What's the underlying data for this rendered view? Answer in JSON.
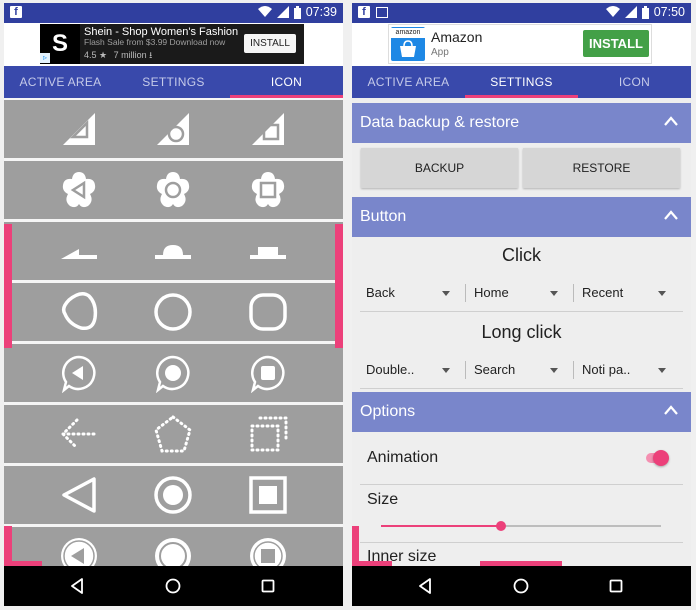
{
  "status_bar": {
    "time_left": "07:39",
    "time_right": "07:50"
  },
  "left_ad": {
    "logo_letter": "S",
    "title": "Shein - Shop Women's Fashion",
    "subtitle": "Flash Sale from $3.99 Download now",
    "rating": "4.5",
    "star": "★",
    "installs": "7 million",
    "button": "INSTALL"
  },
  "right_ad": {
    "title": "Amazon",
    "subtitle": "App",
    "button": "INSTALL",
    "logo_text": "amazon"
  },
  "left_tabs": [
    "ACTIVE AREA",
    "SETTINGS",
    "ICON"
  ],
  "right_tabs": [
    "ACTIVE AREA",
    "SETTINGS",
    "ICON"
  ],
  "settings": {
    "backup_section": {
      "title": "Data backup & restore",
      "backup": "BACKUP",
      "restore": "RESTORE"
    },
    "button_section": {
      "title": "Button",
      "click_label": "Click",
      "click_options": [
        "Back",
        "Home",
        "Recent"
      ],
      "long_click_label": "Long click",
      "long_click_options": [
        "Double..",
        "Search",
        "Noti pa.."
      ]
    },
    "options_section": {
      "title": "Options",
      "animation": "Animation",
      "size": "Size",
      "inner_size": "Inner size",
      "animation_on": true,
      "size_level": 0.43
    }
  },
  "icon_rows": [
    "triangle-icons",
    "flower-icons",
    "tab-icons",
    "rounded-icons",
    "bubble-icons",
    "dotted-icons",
    "ring-icons",
    "circle-icons"
  ],
  "colors": {
    "primary": "#3949ab",
    "status": "#303f9f",
    "accent": "#ec407a",
    "header": "#7986cb",
    "grid": "#9e9e9e"
  }
}
